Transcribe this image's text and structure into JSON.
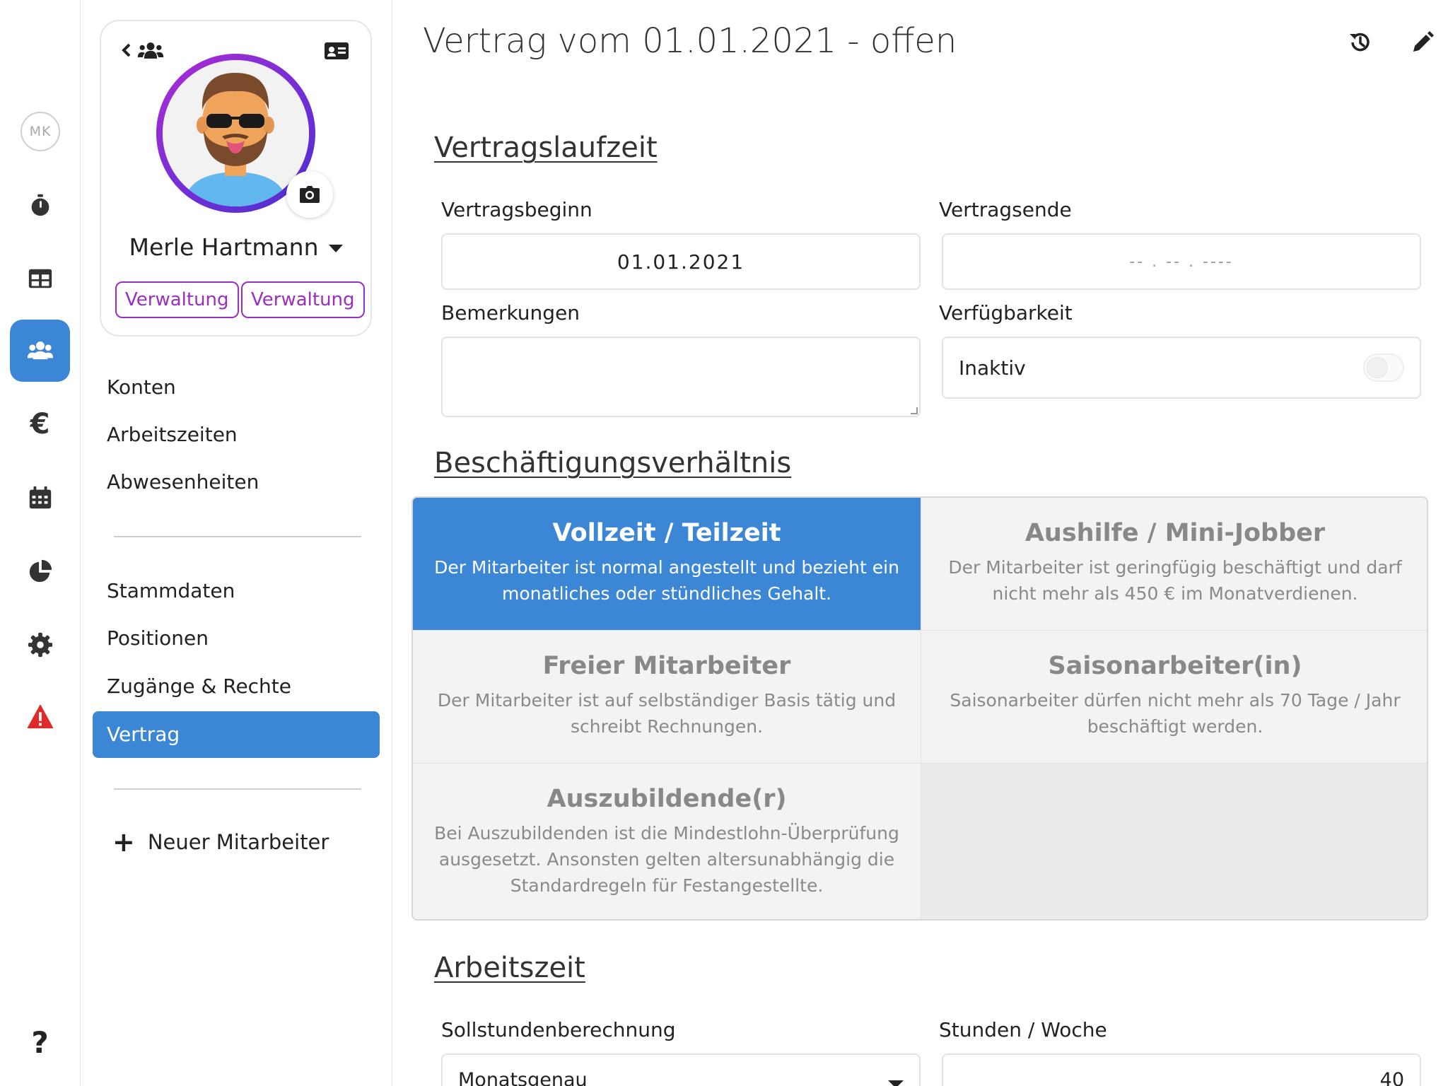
{
  "rail": {
    "avatar_initials": "MK",
    "items": [
      {
        "icon": "stopwatch-icon"
      },
      {
        "icon": "table-icon"
      },
      {
        "icon": "users-icon",
        "active": true
      },
      {
        "icon": "euro-icon",
        "glyph": "€"
      },
      {
        "icon": "calendar-icon"
      },
      {
        "icon": "pie-chart-icon"
      },
      {
        "icon": "gear-icon"
      },
      {
        "icon": "warning-icon"
      }
    ],
    "help_glyph": "?"
  },
  "profile": {
    "name": "Merle Hartmann",
    "roles": [
      "Verwaltung",
      "Verwaltung"
    ]
  },
  "nav": {
    "group1": [
      "Konten",
      "Arbeitszeiten",
      "Abwesenheiten"
    ],
    "group2": [
      "Stammdaten",
      "Positionen",
      "Zugänge & Rechte",
      "Vertrag"
    ],
    "active": "Vertrag",
    "new_employee": "Neuer Mitarbeiter"
  },
  "main": {
    "title": "Vertrag vom 01.01.2021 - offen",
    "sections": {
      "term": "Vertragslaufzeit",
      "employment": "Beschäftigungsverhältnis",
      "worktime": "Arbeitszeit"
    },
    "fields": {
      "start_label": "Vertragsbeginn",
      "start_value": "01.01.2021",
      "end_label": "Vertragsende",
      "end_placeholder": "-- . -- . ----",
      "remarks_label": "Bemerkungen",
      "availability_label": "Verfügbarkeit",
      "availability_value": "Inaktiv",
      "target_hours_label": "Sollstundenberechnung",
      "target_hours_value": "Monatsgenau",
      "hours_week_label": "Stunden / Woche",
      "hours_week_value": "40"
    },
    "employment_types": [
      {
        "title": "Vollzeit / Teilzeit",
        "desc": "Der Mitarbeiter ist normal angestellt und bezieht ein monatliches oder stündliches Gehalt.",
        "selected": true
      },
      {
        "title": "Aushilfe / Mini-Jobber",
        "desc": "Der Mitarbeiter ist geringfügig beschäftigt und darf nicht mehr als 450 € im Monatverdienen.",
        "selected": false
      },
      {
        "title": "Freier Mitarbeiter",
        "desc": "Der Mitarbeiter ist auf selbständiger Basis tätig und schreibt Rechnungen.",
        "selected": false
      },
      {
        "title": "Saisonarbeiter(in)",
        "desc": "Saisonarbeiter dürfen nicht mehr als 70 Tage / Jahr beschäftigt werden.",
        "selected": false
      },
      {
        "title": "Auszubildende(r)",
        "desc": "Bei Auszubildenden ist die Mindestlohn-Überprüfung ausgesetzt. Ansonsten gelten altersunabhängig die Standardregeln für Festangestellte.",
        "selected": false
      }
    ]
  },
  "colors": {
    "accent": "#3b87d6",
    "role_badge": "#9a2fbf",
    "warning": "#e02a2a"
  }
}
